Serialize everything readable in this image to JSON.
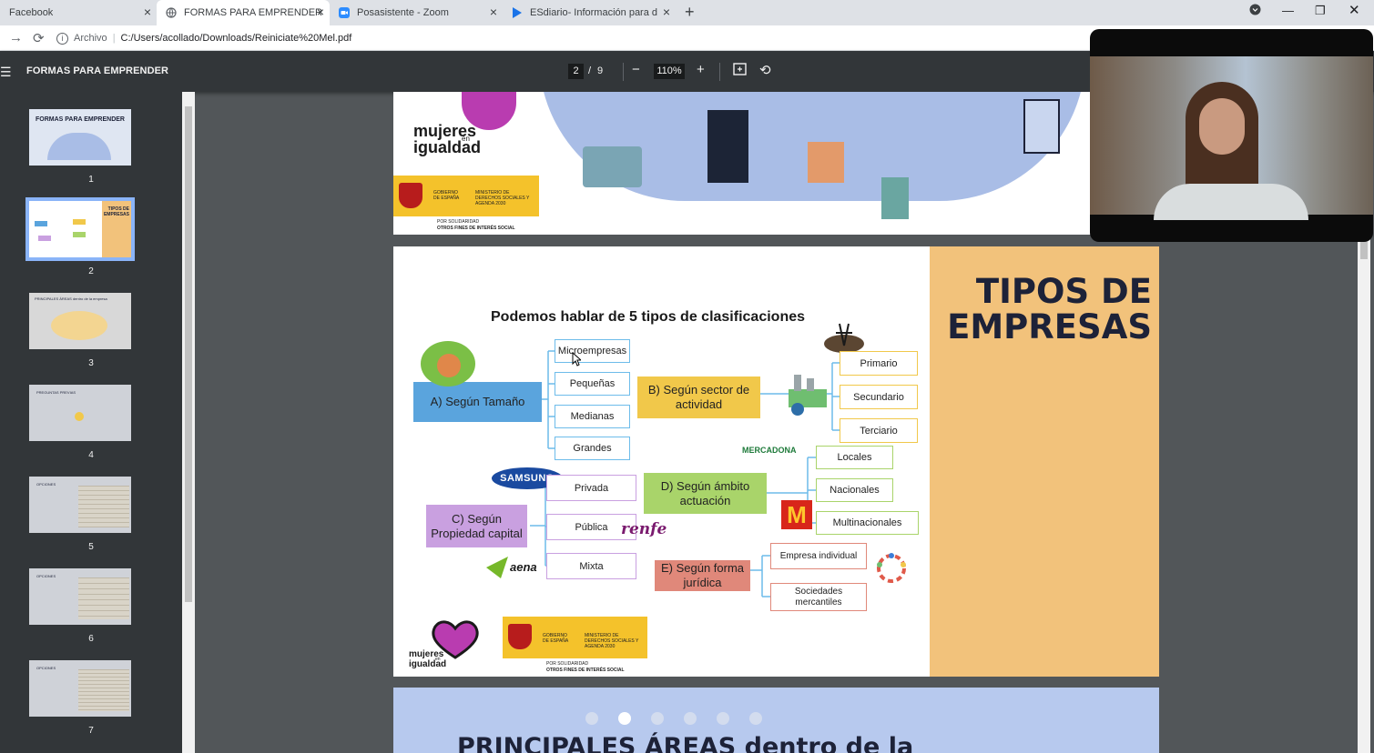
{
  "browser": {
    "tabs": [
      {
        "label": "Facebook"
      },
      {
        "label": "FORMAS PARA EMPRENDER"
      },
      {
        "label": "Posasistente - Zoom"
      },
      {
        "label": "ESdiario- Información para decidir"
      }
    ],
    "address": {
      "scheme": "Archivo",
      "url": "C:/Users/acollado/Downloads/Reiniciate%20Mel.pdf"
    }
  },
  "pdf_toolbar": {
    "title": "FORMAS PARA EMPRENDER",
    "current_page": "2",
    "page_separator": "/",
    "total_pages": "9",
    "zoom": "110%"
  },
  "thumbnails": [
    {
      "num": "1",
      "caption": "FORMAS PARA EMPRENDER"
    },
    {
      "num": "2",
      "caption": "TIPOS DE EMPRESAS"
    },
    {
      "num": "3",
      "caption": "PRINCIPALES ÁREAS dentro de la empresa"
    },
    {
      "num": "4",
      "caption": "PREGUNTAS PREVIAS"
    },
    {
      "num": "5",
      "caption": "OPCIONES"
    },
    {
      "num": "6",
      "caption": "OPCIONES"
    },
    {
      "num": "7",
      "caption": "OPCIONES"
    }
  ],
  "slide1": {
    "brand_line1": "mujeres",
    "brand_en": "en",
    "brand_line2": "igualdad",
    "gov1": "GOBIERNO DE ESPAÑA",
    "gov2": "MINISTERIO DE DERECHOS SOCIALES Y AGENDA 2030",
    "foot1": "POR SOLIDARIDAD",
    "foot2": "OTROS FINES DE INTERÉS SOCIAL"
  },
  "slide2": {
    "title_line1": "TIPOS DE",
    "title_line2": "EMPRESAS",
    "subtitle": "Podemos hablar de 5 tipos de clasificaciones",
    "cat_a": "A) Según Tamaño",
    "a_items": [
      "Microempresas",
      "Pequeñas",
      "Medianas",
      "Grandes"
    ],
    "cat_b": "B) Según sector de actividad",
    "b_items": [
      "Primario",
      "Secundario",
      "Terciario"
    ],
    "cat_c": "C) Según Propiedad capital",
    "c_items": [
      "Privada",
      "Pública",
      "Mixta"
    ],
    "cat_d": "D) Según ámbito actuación",
    "d_items": [
      "Locales",
      "Nacionales",
      "Multinacionales"
    ],
    "cat_e": "E) Según forma jurídica",
    "e_items": [
      "Empresa individual",
      "Sociedades mercantiles"
    ],
    "logos": {
      "samsung": "SAMSUNG",
      "renfe": "renfe",
      "aena": "aena",
      "mercadona": "MERCADONA",
      "mcdonalds": "M"
    },
    "brand_line1": "mujeres",
    "brand_en": "en",
    "brand_line2": "igualdad",
    "gov1": "GOBIERNO DE ESPAÑA",
    "gov2": "MINISTERIO DE DERECHOS SOCIALES Y AGENDA 2030",
    "foot1": "POR SOLIDARIDAD",
    "foot2": "OTROS FINES DE INTERÉS SOCIAL"
  },
  "slide3": {
    "title": "PRINCIPALES ÁREAS dentro de la"
  },
  "colors": {
    "cat_a": "#5aa4dd",
    "cat_b": "#f1c84a",
    "cat_c": "#c9a0e0",
    "cat_d": "#a9d46a",
    "cat_e": "#e0887a",
    "title_panel": "#f2c27b"
  }
}
